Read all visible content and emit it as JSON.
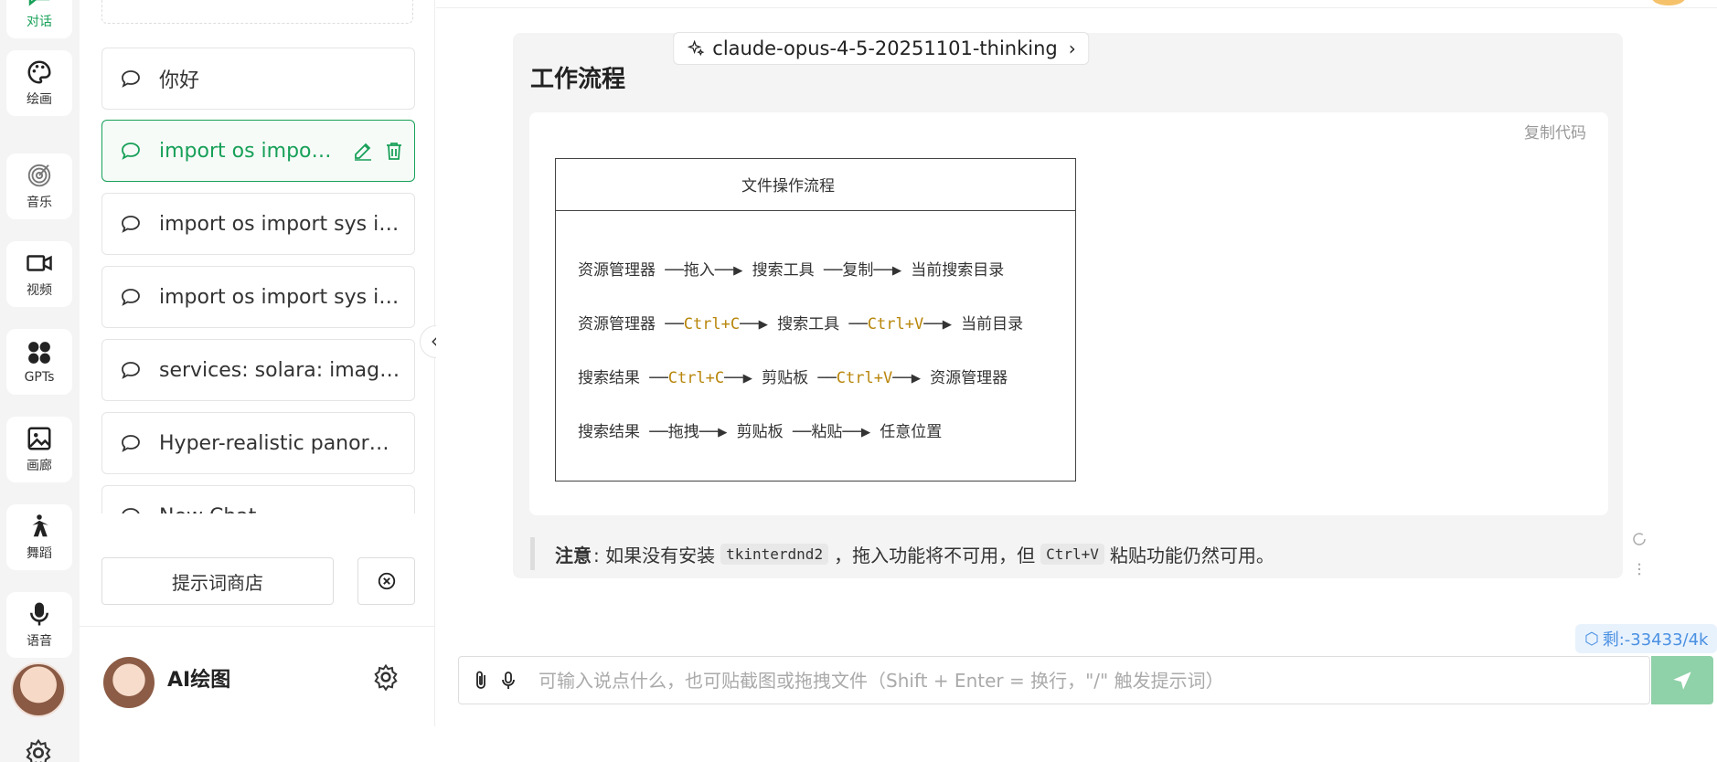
{
  "rail": {
    "items": [
      {
        "label": "对话",
        "icon": "chat-icon",
        "active": true
      },
      {
        "label": "绘画",
        "icon": "palette-icon"
      },
      {
        "label": "音乐",
        "icon": "music-icon"
      },
      {
        "label": "视频",
        "icon": "video-icon"
      },
      {
        "label": "GPTs",
        "icon": "apps-icon"
      },
      {
        "label": "画廊",
        "icon": "gallery-icon"
      },
      {
        "label": "舞蹈",
        "icon": "dance-icon"
      },
      {
        "label": "语音",
        "icon": "mic-icon"
      }
    ]
  },
  "sidebar": {
    "chats": [
      {
        "title": "你好"
      },
      {
        "title": "import os import ...",
        "active": true
      },
      {
        "title": "import os import sys im..."
      },
      {
        "title": "import os import sys im..."
      },
      {
        "title": "services: solara: image: 1..."
      },
      {
        "title": "Hyper-realistic panorami..."
      },
      {
        "title": "New Chat"
      }
    ],
    "prompt_store_label": "提示词商店",
    "user_name": "AI绘图"
  },
  "main": {
    "model_name": "claude-opus-4-5-20251101-thinking",
    "section_title": "工作流程",
    "copy_code_label": "复制代码",
    "diagram": {
      "title": "文件操作流程",
      "rows": [
        {
          "parts": [
            {
              "t": "资源管理器 ──拖入──▶ 搜索工具 ──复制──▶ 当前搜索目录"
            }
          ]
        },
        {
          "parts": [
            {
              "t": "资源管理器 ──"
            },
            {
              "t": "Ctrl+C",
              "kb": true
            },
            {
              "t": "──▶ 搜索工具 ──"
            },
            {
              "t": "Ctrl+V",
              "kb": true
            },
            {
              "t": "──▶ 当前目录"
            }
          ]
        },
        {
          "parts": [
            {
              "t": "搜索结果 ──"
            },
            {
              "t": "Ctrl+C",
              "kb": true
            },
            {
              "t": "──▶ 剪贴板 ──"
            },
            {
              "t": "Ctrl+V",
              "kb": true
            },
            {
              "t": "──▶ 资源管理器"
            }
          ]
        },
        {
          "parts": [
            {
              "t": "搜索结果 ──拖拽──▶ 剪贴板 ──粘贴──▶ 任意位置"
            }
          ]
        }
      ]
    },
    "note": {
      "label": "注意",
      "text_1": ": 如果没有安装",
      "code_1": "tkinterdnd2",
      "text_2": "，拖入功能将不可用，但",
      "code_2": "Ctrl+V",
      "text_3": "粘贴功能仍然可用。"
    },
    "token_badge": "剩:-33433/4k",
    "input_placeholder": "可输入说点什么，也可贴截图或拖拽文件（Shift + Enter = 换行，\"/\" 触发提示词）"
  },
  "colors": {
    "accent": "#18a058",
    "token": "#4a90e2",
    "send": "#8fd1a8"
  }
}
